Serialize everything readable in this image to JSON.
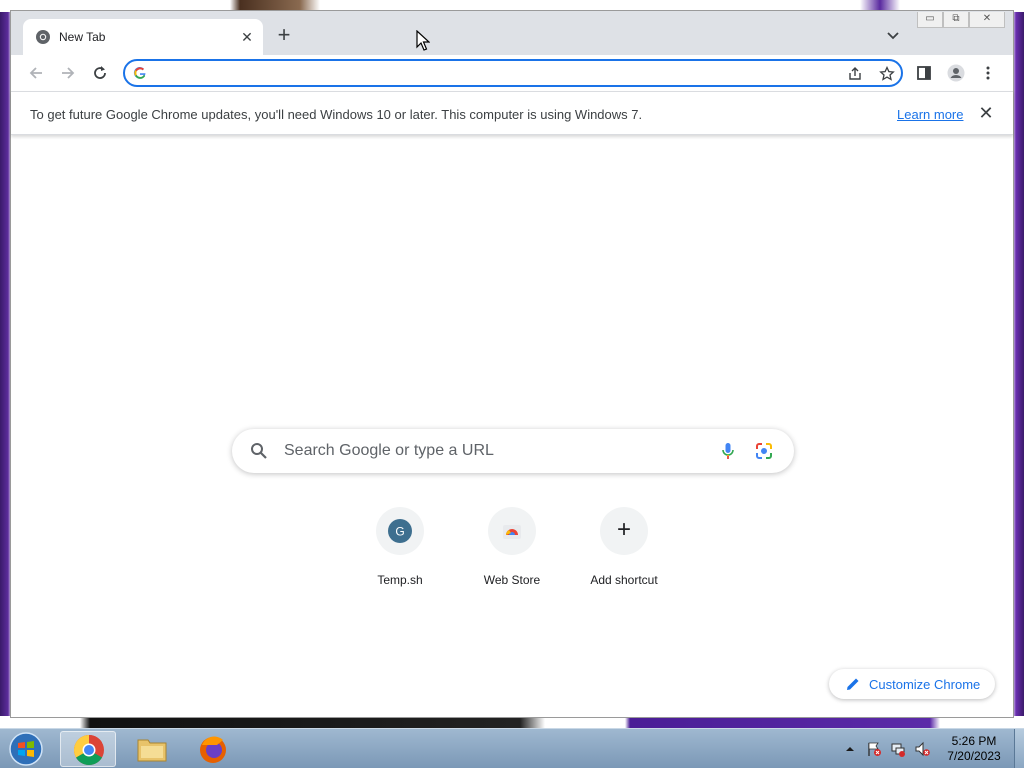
{
  "browser": {
    "tab": {
      "title": "New Tab",
      "close_glyph": "✕"
    },
    "new_tab_glyph": "+",
    "window_controls": {
      "minimize": "▭",
      "restore": "⧉",
      "close": "✕"
    },
    "omnibox": {
      "value": "",
      "placeholder": ""
    },
    "infobar": {
      "message": "To get future Google Chrome updates, you'll need Windows 10 or later. This computer is using Windows 7.",
      "link": "Learn more",
      "close_glyph": "✕"
    }
  },
  "ntp": {
    "search": {
      "placeholder": "Search Google or type a URL"
    },
    "shortcuts": [
      {
        "label": "Temp.sh",
        "icon_letter": "G",
        "icon": "temp-sh-favicon"
      },
      {
        "label": "Web Store",
        "icon": "web-store-icon"
      },
      {
        "label": "Add shortcut",
        "icon": "plus-icon",
        "glyph": "+"
      }
    ],
    "customize": {
      "label": "Customize Chrome"
    }
  },
  "taskbar": {
    "clock": {
      "time": "5:26 PM",
      "date": "7/20/2023"
    },
    "apps": [
      "start-orb",
      "chrome",
      "file-explorer",
      "firefox"
    ]
  },
  "colors": {
    "accent": "#1a73e8",
    "tabstrip": "#dee1e6",
    "taskbar": "#8aa6c2"
  }
}
